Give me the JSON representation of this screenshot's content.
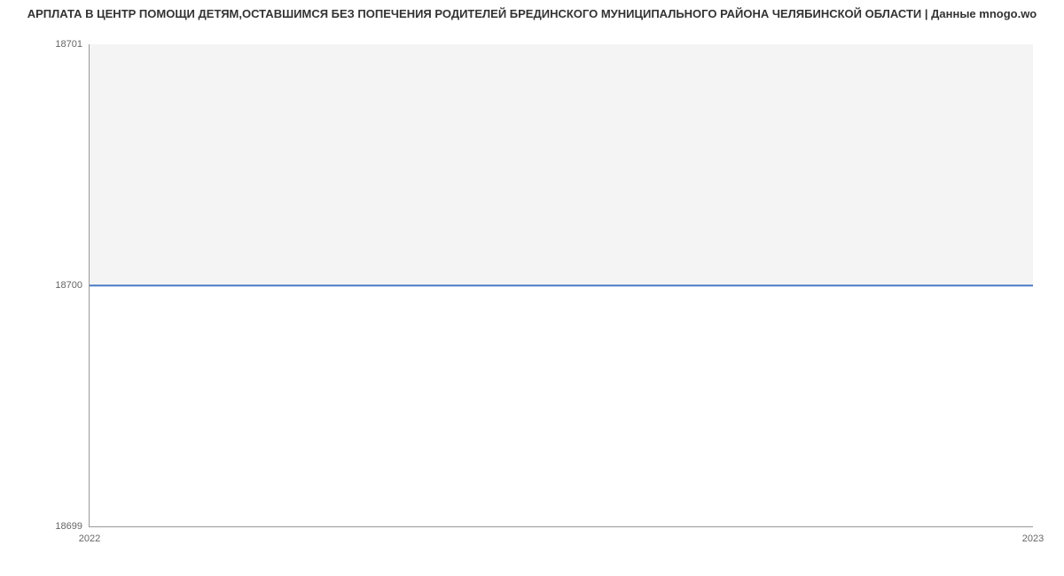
{
  "chart_data": {
    "type": "line",
    "title": "АРПЛАТА В ЦЕНТР ПОМОЩИ ДЕТЯМ,ОСТАВШИМСЯ БЕЗ ПОПЕЧЕНИЯ РОДИТЕЛЕЙ БРЕДИНСКОГО МУНИЦИПАЛЬНОГО РАЙОНА ЧЕЛЯБИНСКОЙ ОБЛАСТИ | Данные mnogo.wo",
    "x": [
      2022,
      2023
    ],
    "values": [
      18700,
      18700
    ],
    "xlabel": "",
    "ylabel": "",
    "ylim": [
      18699,
      18701
    ],
    "xlim": [
      2022,
      2023
    ],
    "y_ticks": [
      18699,
      18700,
      18701
    ],
    "x_ticks": [
      2022,
      2023
    ]
  },
  "ticks": {
    "y_top": "18701",
    "y_mid": "18700",
    "y_bot": "18699",
    "x_left": "2022",
    "x_right": "2023"
  }
}
